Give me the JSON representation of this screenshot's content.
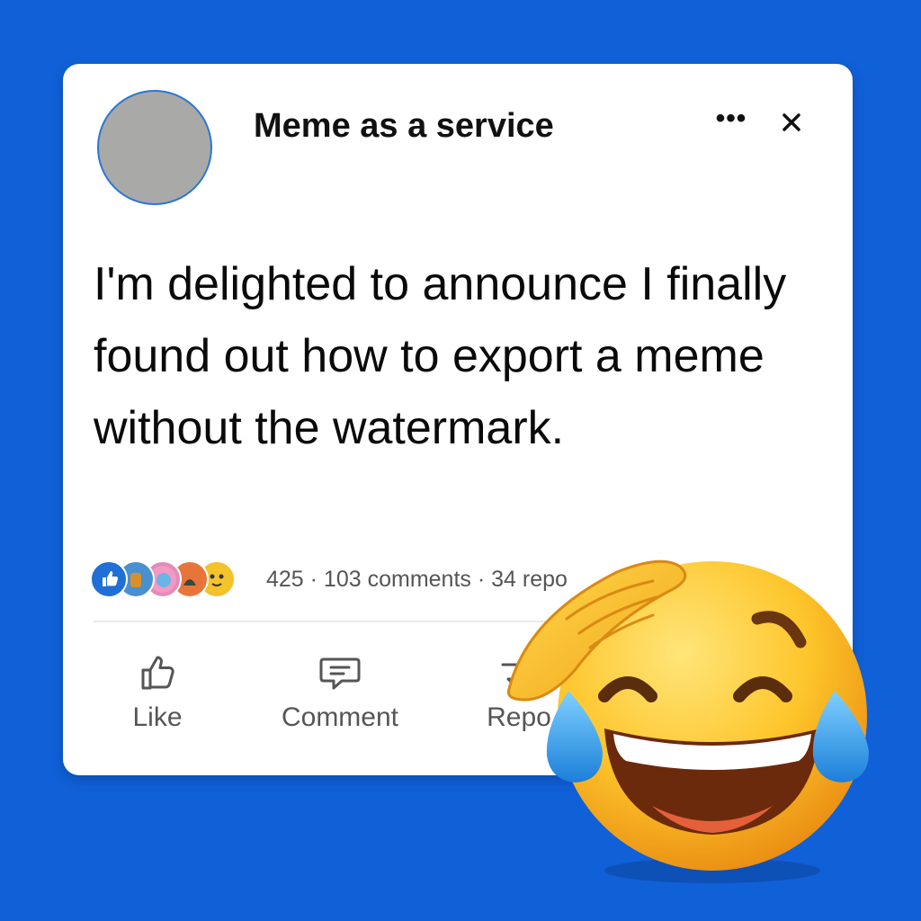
{
  "post": {
    "author": "Meme as a service",
    "text": "I'm delighted to announce I finally found out how to export a meme without the watermark.",
    "stats": "425 · 103 comments · 34 repo",
    "reaction_icons": [
      "like-icon",
      "avatar-reaction-1",
      "avatar-reaction-2",
      "avatar-reaction-3",
      "avatar-reaction-4"
    ]
  },
  "header": {
    "more_icon": "more-options-icon",
    "close_icon": "close-icon"
  },
  "actions": {
    "like": "Like",
    "comment": "Comment",
    "repost": "Repo"
  },
  "colors": {
    "background": "#1060d8",
    "card": "#ffffff",
    "avatar_border": "#2b76d2",
    "like_blue": "#1f6fd6"
  },
  "overlay": {
    "icon": "laughing-salute-emoji"
  }
}
